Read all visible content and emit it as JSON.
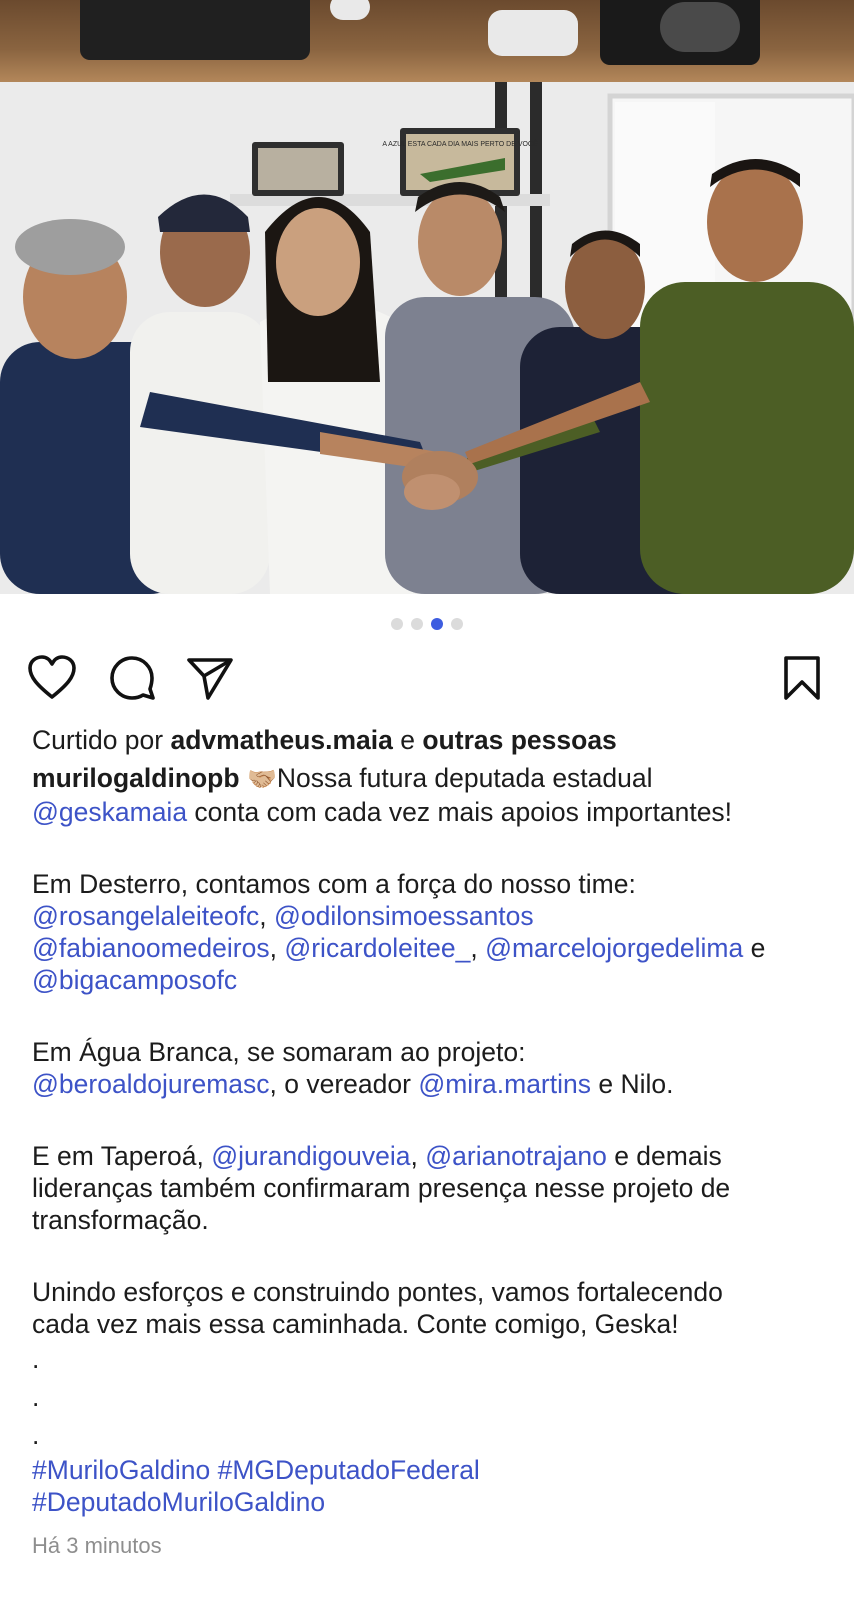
{
  "post": {
    "carousel": {
      "count": 4,
      "active_index": 2
    },
    "plaque_texts": [
      "A AZUL ESTA CADA DIA MAIS PERTO DE VOCÊ"
    ],
    "likes": {
      "prefix": "Curtido por",
      "user": "advmatheus.maia",
      "joiner": "e",
      "others": "outras pessoas"
    },
    "caption": {
      "author": "murilogaldinopb",
      "emoji": "🤝🏼",
      "line1_text": "Nossa futura deputada estadual",
      "mention_geska": "@geskamaia",
      "line2_text": " conta com cada vez mais apoios importantes!",
      "desterro_intro": "Em Desterro, contamos com a força do nosso time:",
      "desterro_mentions": [
        "@rosangelaleiteofc",
        "@odilonsimoessantos",
        "@fabianoomedeiros",
        "@ricardoleitee_",
        "@marcelojorgedelima",
        "@bigacamposofc"
      ],
      "comma": ",",
      "and": " e",
      "agua_intro": "Em Água Branca, se somaram ao projeto:",
      "agua_mention1": "@beroaldojuremasc",
      "agua_mid": ", o vereador ",
      "agua_mention2": "@mira.martins",
      "agua_end": " e Nilo.",
      "taperoa_prefix": "E em Taperoá, ",
      "taperoa_mention1": "@jurandigouveia",
      "taperoa_sep": ", ",
      "taperoa_mention2": "@arianotrajano",
      "taperoa_line1_end": " e demais",
      "taperoa_line2": "lideranças também confirmaram presença nesse projeto de",
      "taperoa_line3": "transformação.",
      "closing_line1": "Unindo esforços e construindo pontes, vamos fortalecendo",
      "closing_line2": "cada vez mais essa caminhada. Conte comigo, Geska!",
      "dot": ".",
      "hashtag1": "#MuriloGaldino",
      "hashtag2": "#MGDeputadoFederal",
      "hashtag3": "#DeputadoMuriloGaldino"
    },
    "timestamp": "Há 3 minutos",
    "icons": [
      "heart-icon",
      "comment-icon",
      "share-icon",
      "bookmark-icon"
    ],
    "colors": {
      "link": "#3d53c7",
      "dot_active": "#3d5de0",
      "dot_inactive": "#dbdbdb",
      "timestamp": "#8e8e8e"
    }
  }
}
